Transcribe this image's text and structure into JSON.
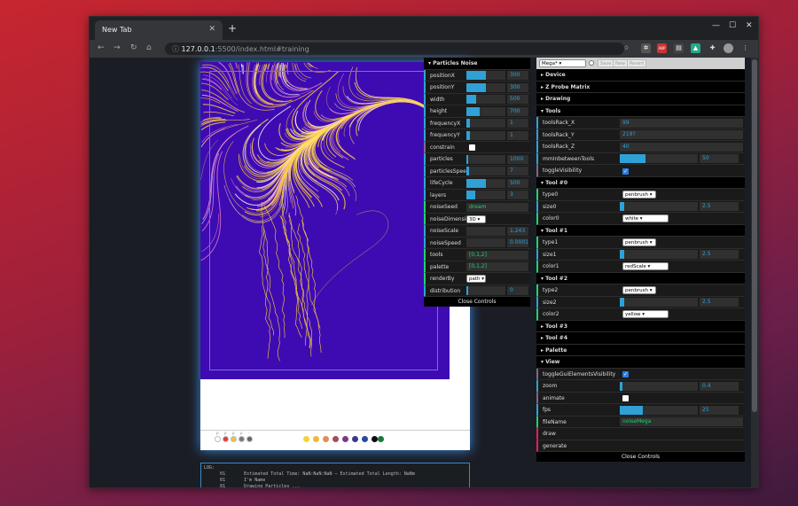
{
  "browser": {
    "tab_title": "New Tab",
    "url_host": "127.0.0.1",
    "url_rest": ":5500/index.html#training",
    "extensions": [
      "star-icon",
      "settings-ext",
      "abp-ext",
      "pdf-ext",
      "drive-ext",
      "puzzle-icon",
      "profile-avatar",
      "menu-icon"
    ]
  },
  "art_colors": {
    "background": "#3e0bb2",
    "yellow": "#ffd23a",
    "pink": "#e986c8",
    "white": "#ffffff"
  },
  "palette_swatches": [
    "#f7d23a",
    "#f2b63a",
    "#e98a55",
    "#a34c60",
    "#7a3a8a",
    "#3b3a8a",
    "#2a4aa0",
    "#0c0c12",
    "#1a7a3a"
  ],
  "small_swatches": [
    "#ffffff",
    "#e43a3a",
    "#f2c13a",
    "#777777",
    "#666666"
  ],
  "small_swatch_labels": [
    "p",
    "p",
    "p",
    "p",
    "-"
  ],
  "log": {
    "header": "LOG:",
    "lines": [
      "      01       Estimated Total Time: NaN:NaN:NaN — Estimated Total Length: NaNm",
      "      01       I'm Name",
      "      01       Drawing Particles ..."
    ]
  },
  "left_gui": {
    "folder": "▾ Particles Noise",
    "rows": [
      {
        "type": "num",
        "label": "positionX",
        "value": "300",
        "fill": 0.5
      },
      {
        "type": "num",
        "label": "positionY",
        "value": "300",
        "fill": 0.5
      },
      {
        "type": "num",
        "label": "width",
        "value": "500",
        "fill": 0.25
      },
      {
        "type": "num",
        "label": "height",
        "value": "700",
        "fill": 0.35
      },
      {
        "type": "num",
        "label": "frequencyX",
        "value": "1",
        "fill": 0.08
      },
      {
        "type": "num",
        "label": "frequencyY",
        "value": "1",
        "fill": 0.08
      },
      {
        "type": "bool",
        "label": "constrain",
        "checked": false
      },
      {
        "type": "num",
        "label": "particles",
        "value": "1000",
        "fill": 0.04
      },
      {
        "type": "num",
        "label": "particlesSpeed",
        "value": "7",
        "fill": 0.06
      },
      {
        "type": "num",
        "label": "lifeCycle",
        "value": "500",
        "fill": 0.5
      },
      {
        "type": "num",
        "label": "layers",
        "value": "3",
        "fill": 0.22
      },
      {
        "type": "str",
        "label": "noiseSeed",
        "value": "dream"
      },
      {
        "type": "sel",
        "label": "noiseDimension",
        "value": "3D"
      },
      {
        "type": "num",
        "label": "noiseScale",
        "value": "1.243",
        "fill": 0.0
      },
      {
        "type": "num",
        "label": "noiseSpeed",
        "value": "0.0001",
        "fill": 0.0
      },
      {
        "type": "str",
        "label": "tools",
        "value": "[0,1,2]"
      },
      {
        "type": "str",
        "label": "palette",
        "value": "[0,1,2]"
      },
      {
        "type": "sel",
        "label": "renderBy",
        "value": "path"
      },
      {
        "type": "num",
        "label": "distribution",
        "value": "0",
        "fill": 0.05
      }
    ],
    "close": "Close Controls"
  },
  "right_gui": {
    "preset": {
      "value": "Mega*",
      "save": "Save",
      "new": "New",
      "revert": "Revert"
    },
    "rows": [
      {
        "type": "folder",
        "label": "▸ Device"
      },
      {
        "type": "folder",
        "label": "▸ Z Probe Matrix"
      },
      {
        "type": "folder",
        "label": "▸ Drawing"
      },
      {
        "type": "folder",
        "label": "▾ Tools"
      },
      {
        "type": "num",
        "label": "toolsRack_X",
        "value": "99",
        "fill": 0
      },
      {
        "type": "num",
        "label": "toolsRack_Y",
        "value": "219?",
        "fill": 0
      },
      {
        "type": "num",
        "label": "toolsRack_Z",
        "value": "40",
        "fill": 0
      },
      {
        "type": "num",
        "label": "mmInbetweenTools",
        "value": "50",
        "fill": 0.33
      },
      {
        "type": "bool",
        "label": "toggleVisibility",
        "checked": true
      },
      {
        "type": "folder",
        "label": "▾ Tool #0"
      },
      {
        "type": "sel2",
        "label": "type0",
        "value": "penbrush"
      },
      {
        "type": "num2",
        "label": "size0",
        "value": "2.5",
        "fill": 0.06
      },
      {
        "type": "sel2",
        "label": "color0",
        "value": "white"
      },
      {
        "type": "folder",
        "label": "▾ Tool #1"
      },
      {
        "type": "sel2",
        "label": "type1",
        "value": "penbrush"
      },
      {
        "type": "num2",
        "label": "size1",
        "value": "2.5",
        "fill": 0.06
      },
      {
        "type": "sel2",
        "label": "color1",
        "value": "redScale"
      },
      {
        "type": "folder",
        "label": "▾ Tool #2"
      },
      {
        "type": "sel2",
        "label": "type2",
        "value": "penbrush"
      },
      {
        "type": "num2",
        "label": "size2",
        "value": "2.5",
        "fill": 0.06
      },
      {
        "type": "sel2",
        "label": "color2",
        "value": "yellow"
      },
      {
        "type": "folder",
        "label": "▸ Tool #3"
      },
      {
        "type": "folder",
        "label": "▸ Tool #4"
      },
      {
        "type": "folder",
        "label": "▸ Palette"
      },
      {
        "type": "folder",
        "label": "▾ View"
      },
      {
        "type": "bool",
        "label": "toggleGuiElementsVisibility",
        "checked": true
      },
      {
        "type": "num",
        "label": "zoom",
        "value": "0.4",
        "fill": 0.03
      },
      {
        "type": "bool",
        "label": "animate",
        "checked": false
      },
      {
        "type": "num",
        "label": "fps",
        "value": "25",
        "fill": 0.3
      },
      {
        "type": "str",
        "label": "fileName",
        "value": "noiseMega"
      },
      {
        "type": "fn",
        "label": "draw"
      },
      {
        "type": "fn",
        "label": "generate"
      }
    ],
    "close": "Close Controls"
  }
}
